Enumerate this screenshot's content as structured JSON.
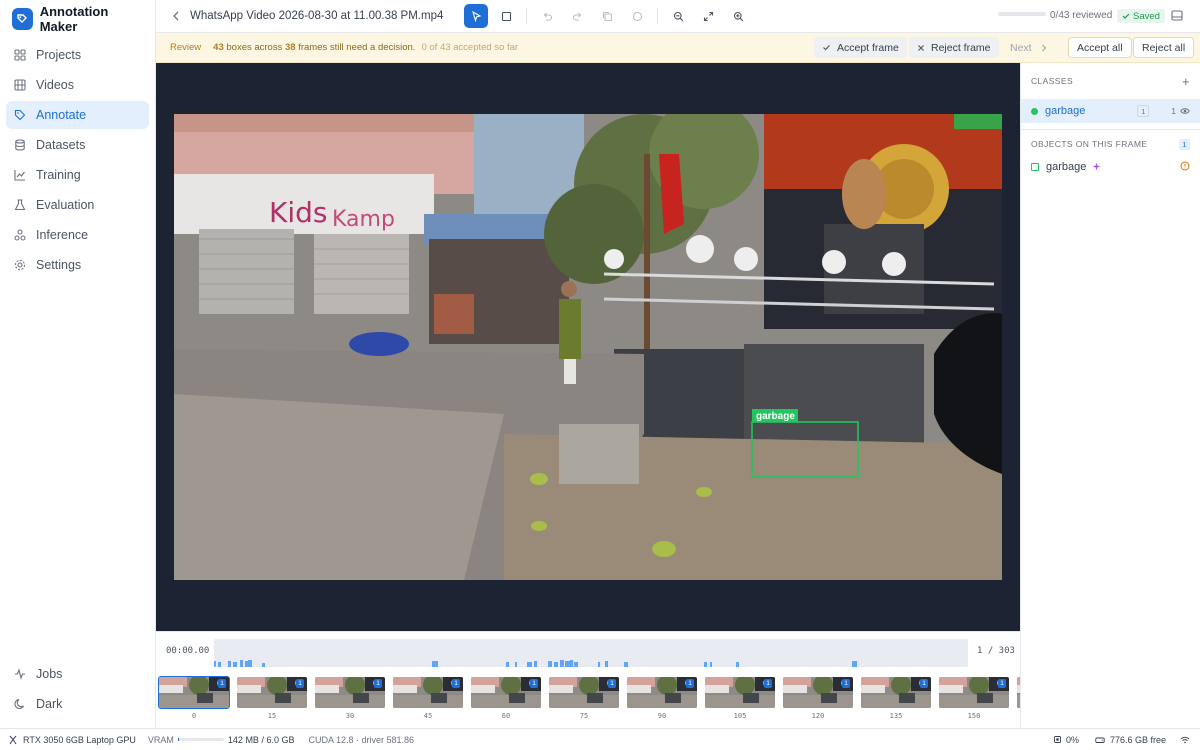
{
  "app": {
    "name": "Annotation Maker"
  },
  "sidebar": {
    "items": [
      {
        "label": "Projects",
        "icon": "grid-icon"
      },
      {
        "label": "Videos",
        "icon": "film-icon"
      },
      {
        "label": "Annotate",
        "icon": "tag-icon",
        "active": true
      },
      {
        "label": "Datasets",
        "icon": "database-icon"
      },
      {
        "label": "Training",
        "icon": "chart-line-icon"
      },
      {
        "label": "Evaluation",
        "icon": "flask-icon"
      },
      {
        "label": "Inference",
        "icon": "nodes-icon"
      },
      {
        "label": "Settings",
        "icon": "gear-icon"
      }
    ],
    "bottom": [
      {
        "label": "Jobs",
        "icon": "activity-icon"
      },
      {
        "label": "Dark",
        "icon": "moon-icon"
      }
    ]
  },
  "topbar": {
    "filename": "WhatsApp Video 2026-08-30 at 11.00.38 PM.mp4",
    "reviewed_text": "0/43 reviewed",
    "reviewed_fraction": 0,
    "saved_label": "Saved",
    "tools": [
      "select-tool-icon",
      "box-tool-icon",
      "undo-icon",
      "redo-icon",
      "copy-icon",
      "circle-icon",
      "zoom-out-icon",
      "fit-icon",
      "zoom-in-icon"
    ]
  },
  "review": {
    "label": "Review",
    "boxes": "43",
    "boxes_text": "boxes across",
    "frames": "38",
    "frames_text": "frames still need a decision.",
    "accepted_text": "0 of 43 accepted so far",
    "accept_frame": "Accept frame",
    "reject_frame": "Reject frame",
    "next": "Next",
    "accept_all": "Accept all",
    "reject_all": "Reject all"
  },
  "canvas": {
    "box_label": "garbage",
    "box_color": "#22c55e"
  },
  "panel": {
    "classes_title": "CLASSES",
    "classes": [
      {
        "name": "garbage",
        "hotkey": "1",
        "count": "1",
        "color": "#22c55e"
      }
    ],
    "objects_title": "OBJECTS ON THIS FRAME",
    "objects_count": "1",
    "objects": [
      {
        "name": "garbage"
      }
    ]
  },
  "timeline": {
    "time": "00:00.00",
    "frame_counter": "1 / 303",
    "thumbs": [
      {
        "label": "0",
        "badge": "1",
        "selected": true
      },
      {
        "label": "15",
        "badge": "1"
      },
      {
        "label": "30",
        "badge": "1"
      },
      {
        "label": "45",
        "badge": "1"
      },
      {
        "label": "60",
        "badge": "1"
      },
      {
        "label": "75",
        "badge": "1"
      },
      {
        "label": "90",
        "badge": "1"
      },
      {
        "label": "105",
        "badge": "1"
      },
      {
        "label": "120",
        "badge": "1"
      },
      {
        "label": "135",
        "badge": "1"
      },
      {
        "label": "150",
        "badge": "1"
      },
      {
        "label": "",
        "badge": ""
      }
    ]
  },
  "status": {
    "gpu": "RTX 3050 6GB Laptop GPU",
    "vram_label": "VRAM",
    "vram_value": "142 MB / 6.0 GB",
    "vram_fraction": 0.023,
    "cuda": "CUDA 12.8 · driver 581.86",
    "cpu": "0%",
    "disk": "776.6 GB free"
  }
}
